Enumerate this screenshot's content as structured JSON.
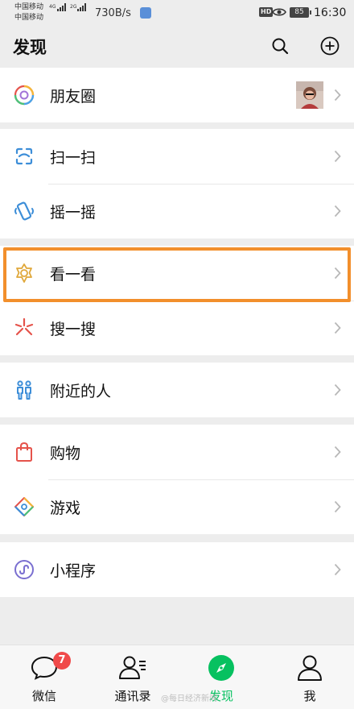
{
  "status_bar": {
    "carrier_1": "中国移动",
    "carrier_2": "中国移动",
    "network_1": "4G",
    "network_2": "2G",
    "net_speed": "730B/s",
    "hd": "HD",
    "battery": "85",
    "time": "16:30"
  },
  "header": {
    "title": "发现",
    "icons": [
      "search-icon",
      "add-icon"
    ]
  },
  "groups": [
    {
      "items": [
        {
          "label": "朋友圈",
          "icon": "moments-icon",
          "has_thumbnail": true
        }
      ]
    },
    {
      "items": [
        {
          "label": "扫一扫",
          "icon": "scan-icon"
        },
        {
          "label": "摇一摇",
          "icon": "shake-icon"
        }
      ]
    },
    {
      "items": [
        {
          "label": "看一看",
          "icon": "top-stories-icon",
          "highlighted": true
        },
        {
          "label": "搜一搜",
          "icon": "search-flash-icon"
        }
      ]
    },
    {
      "items": [
        {
          "label": "附近的人",
          "icon": "people-nearby-icon"
        }
      ]
    },
    {
      "items": [
        {
          "label": "购物",
          "icon": "shopping-bag-icon"
        },
        {
          "label": "游戏",
          "icon": "games-icon"
        }
      ]
    },
    {
      "items": [
        {
          "label": "小程序",
          "icon": "mini-programs-icon"
        }
      ]
    }
  ],
  "tab_bar": {
    "tabs": [
      {
        "label": "微信",
        "icon": "chats-icon",
        "badge": "7"
      },
      {
        "label": "通讯录",
        "icon": "contacts-icon"
      },
      {
        "label": "发现",
        "icon": "discover-icon",
        "active": true
      },
      {
        "label": "我",
        "icon": "me-icon"
      }
    ]
  },
  "colors": {
    "accent_green": "#07c160",
    "highlight_orange": "#f28f2c",
    "badge_red": "#f04a4a",
    "background": "#ededed"
  },
  "watermark": "@每日经济新闻"
}
